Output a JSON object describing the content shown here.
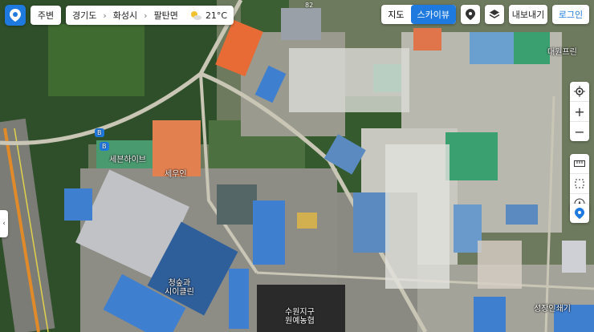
{
  "toolbar": {
    "nearby_label": "주변",
    "breadcrumb": [
      "경기도",
      "화성시",
      "팔탄면"
    ],
    "weather_temp": "21°C",
    "view_map": "지도",
    "view_sky": "스카이뷰",
    "export_label": "내보내기",
    "login_label": "로그인"
  },
  "labels": {
    "cafe": "세븐하이브",
    "church": "세우인",
    "plant_line1": "청숲과",
    "plant_line2": "시이클린",
    "farm_line1": "수원지구",
    "farm_line2": "원예농협",
    "company_top": "대원프린",
    "company_bottom": "성장인쇄기",
    "bus_stop": "B",
    "road_route": "82"
  },
  "colors": {
    "accent": "#1f7ae0",
    "roof_orange": "#e86a34",
    "roof_blue": "#3f7fd0",
    "roof_green": "#3aa070"
  },
  "map_icons": [
    "logo-icon",
    "weather-icon",
    "location-pin-icon",
    "layers-icon",
    "target-icon",
    "zoom-in-icon",
    "zoom-out-icon",
    "ruler-icon",
    "area-icon",
    "compass-icon"
  ]
}
